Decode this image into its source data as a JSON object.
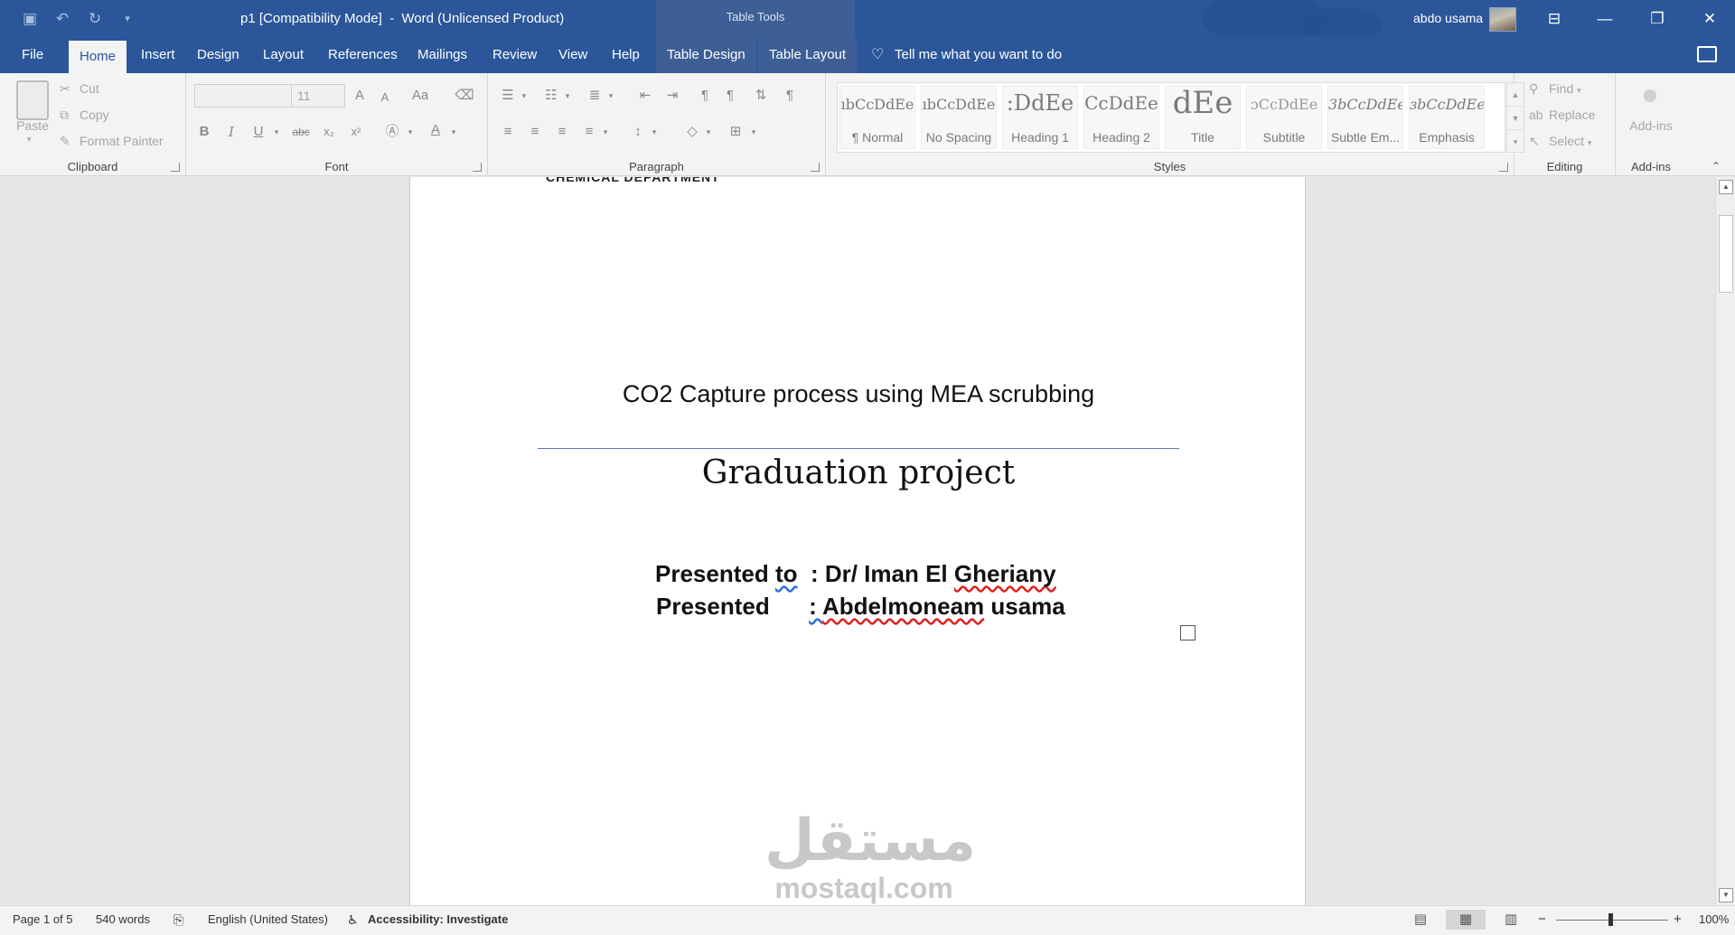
{
  "window": {
    "title": "p1 [Compatibility Mode]  -  Word (Unlicensed Product)",
    "context_tab_title": "Table Tools",
    "user_name": "abdo usama",
    "quick_access": [
      "save-icon",
      "undo-icon",
      "redo-icon",
      "customize-qat-icon"
    ],
    "controls": [
      "ribbon-display-options-icon",
      "minimize-icon",
      "restore-icon",
      "close-icon"
    ]
  },
  "tabs": [
    {
      "label": "File"
    },
    {
      "label": "Home",
      "active": true
    },
    {
      "label": "Insert"
    },
    {
      "label": "Design"
    },
    {
      "label": "Layout"
    },
    {
      "label": "References"
    },
    {
      "label": "Mailings"
    },
    {
      "label": "Review"
    },
    {
      "label": "View"
    },
    {
      "label": "Help"
    },
    {
      "label": "Table Design"
    },
    {
      "label": "Table Layout"
    }
  ],
  "tell_me": "Tell me what you want to do",
  "clipboard": {
    "label": "Clipboard",
    "paste": "Paste",
    "cut": "Cut",
    "copy": "Copy",
    "format_painter": "Format Painter"
  },
  "font": {
    "label": "Font",
    "font_name": "",
    "font_size": "11",
    "grow": "A",
    "shrink": "A",
    "change_case": "Aa",
    "bold": "B",
    "italic": "I",
    "underline": "U",
    "strike": "abc",
    "subscript": "x₂",
    "superscript": "x²",
    "font_color": "A"
  },
  "paragraph": {
    "label": "Paragraph"
  },
  "styles": {
    "label": "Styles",
    "items": [
      {
        "sample": "ıbCcDdEe",
        "name": "¶ Normal"
      },
      {
        "sample": "ıbCcDdEe",
        "name": "No Spacing"
      },
      {
        "sample": ":DdEe",
        "name": "Heading 1"
      },
      {
        "sample": "CcDdEe",
        "name": "Heading 2"
      },
      {
        "sample": "dEe",
        "name": "Title"
      },
      {
        "sample": "ɔCcDdEe",
        "name": "Subtitle"
      },
      {
        "sample": "3bCcDdEe",
        "name": "Subtle Em..."
      },
      {
        "sample": "ɜbCcDdEe",
        "name": "Emphasis"
      }
    ]
  },
  "editing": {
    "label": "Editing",
    "find": "Find",
    "replace": "Replace",
    "select": "Select"
  },
  "addins": {
    "label": "Add-ins",
    "button": "Add-ins"
  },
  "document": {
    "cut_heading": "CHEMICAL DEPARTMENT",
    "subtitle": "CO2 Capture process using MEA scrubbing",
    "title": "Graduation project",
    "presented_to_label": "Presented ",
    "presented_to_word": "to",
    "presented_to_colon": "  : Dr/ Iman El ",
    "presented_to_name": "Gheriany",
    "presented_by_label": "Presented      ",
    "presented_by_colon": ": ",
    "presented_by_name": "Abdelmoneam",
    "presented_by_last": " usama",
    "watermark_ar": "مستقل",
    "watermark_en": "mostaql.com"
  },
  "status": {
    "page": "Page 1 of 5",
    "words": "540 words",
    "language": "English (United States)",
    "accessibility": "Accessibility: Investigate",
    "zoom": "100%"
  }
}
